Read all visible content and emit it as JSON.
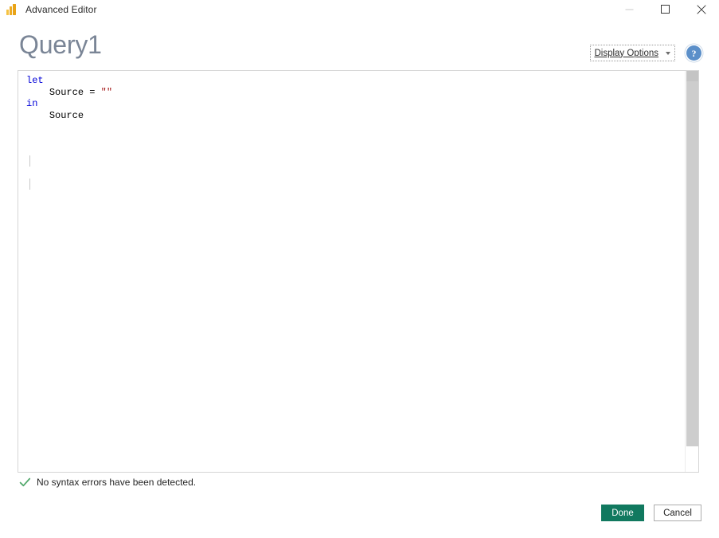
{
  "window": {
    "icon_name": "power-query-bars-icon",
    "title": "Advanced Editor",
    "controls": {
      "minimize_label": "Minimize",
      "maximize_label": "Maximize",
      "close_label": "Close"
    }
  },
  "header": {
    "page_title": "Query1",
    "display_options_label": "Display Options",
    "help_label": "?"
  },
  "editor": {
    "lines": [
      {
        "indent": 0,
        "tokens": [
          {
            "text": "let",
            "type": "kw"
          }
        ]
      },
      {
        "indent": 1,
        "tokens": [
          {
            "text": "Source = ",
            "type": "id"
          },
          {
            "text": "\"\"",
            "type": "str"
          }
        ]
      },
      {
        "indent": 0,
        "tokens": [
          {
            "text": "in",
            "type": "kw"
          }
        ]
      },
      {
        "indent": 1,
        "tokens": [
          {
            "text": "Source",
            "type": "id"
          }
        ]
      }
    ]
  },
  "status": {
    "icon_name": "green-check-icon",
    "message": "No syntax errors have been detected."
  },
  "footer": {
    "done_label": "Done",
    "cancel_label": "Cancel"
  },
  "colors": {
    "accent_done": "#11795f",
    "keyword": "#0000d8",
    "string": "#a31515",
    "title": "#7a8596",
    "help": "#5b8fc9",
    "check": "#53a96d"
  }
}
